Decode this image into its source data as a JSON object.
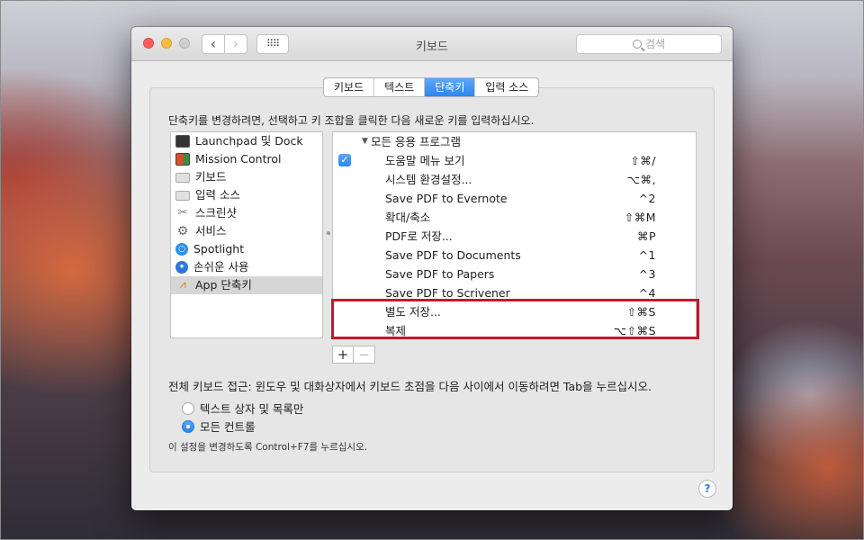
{
  "window": {
    "title": "키보드",
    "search_placeholder": "검색",
    "nav_back": "‹",
    "nav_forward": "›",
    "grid": "⠿⠿"
  },
  "tabs": [
    {
      "label": "키보드",
      "active": false
    },
    {
      "label": "텍스트",
      "active": false
    },
    {
      "label": "단축키",
      "active": true
    },
    {
      "label": "입력 소스",
      "active": false
    }
  ],
  "instructions": "단축키를 변경하려면, 선택하고 키 조합을 클릭한 다음 새로운 키를 입력하십시오.",
  "categories": [
    {
      "label": "Launchpad 및 Dock",
      "icon": "launchpad-icon"
    },
    {
      "label": "Mission Control",
      "icon": "mission-control-icon"
    },
    {
      "label": "키보드",
      "icon": "keyboard-icon"
    },
    {
      "label": "입력 소스",
      "icon": "keyboard-icon"
    },
    {
      "label": "스크린샷",
      "icon": "screenshot-icon"
    },
    {
      "label": "서비스",
      "icon": "gear-icon"
    },
    {
      "label": "Spotlight",
      "icon": "spotlight-icon"
    },
    {
      "label": "손쉬운 사용",
      "icon": "accessibility-icon"
    },
    {
      "label": "App 단축키",
      "icon": "app-shortcuts-icon",
      "selected": true
    }
  ],
  "shortcuts": {
    "group_label": "모든 응용 프로그램",
    "rows": [
      {
        "label": "도움말 메뉴 보기",
        "shortcut": "⇧⌘/",
        "checked": true
      },
      {
        "label": "시스템 환경설정...",
        "shortcut": "⌥⌘,"
      },
      {
        "label": "Save PDF to Evernote",
        "shortcut": "^2"
      },
      {
        "label": "확대/축소",
        "shortcut": "⇧⌘M"
      },
      {
        "label": "PDF로 저장...",
        "shortcut": "⌘P"
      },
      {
        "label": "Save PDF to Documents",
        "shortcut": "^1"
      },
      {
        "label": "Save PDF to Papers",
        "shortcut": "^3"
      },
      {
        "label": "Save PDF to Scrivener",
        "shortcut": "^4"
      },
      {
        "label": "별도 저장...",
        "shortcut": "⇧⌘S"
      },
      {
        "label": "복제",
        "shortcut": "⌥⇧⌘S"
      }
    ]
  },
  "buttons": {
    "add": "+",
    "remove": "−",
    "help": "?"
  },
  "full_access": {
    "label": "전체 키보드 접근: 윈도우 및 대화상자에서 키보드 초점을 다음 사이에서 이동하려면 Tab을 누르십시오.",
    "options": [
      {
        "label": "텍스트 상자 및 목록만",
        "selected": false
      },
      {
        "label": "모든 컨트롤",
        "selected": true
      }
    ],
    "note": "이 설정을 변경하도록 Control+F7를 누르십시오."
  },
  "colors": {
    "accent": "#2c85f2",
    "highlight_border": "#c5172c"
  }
}
